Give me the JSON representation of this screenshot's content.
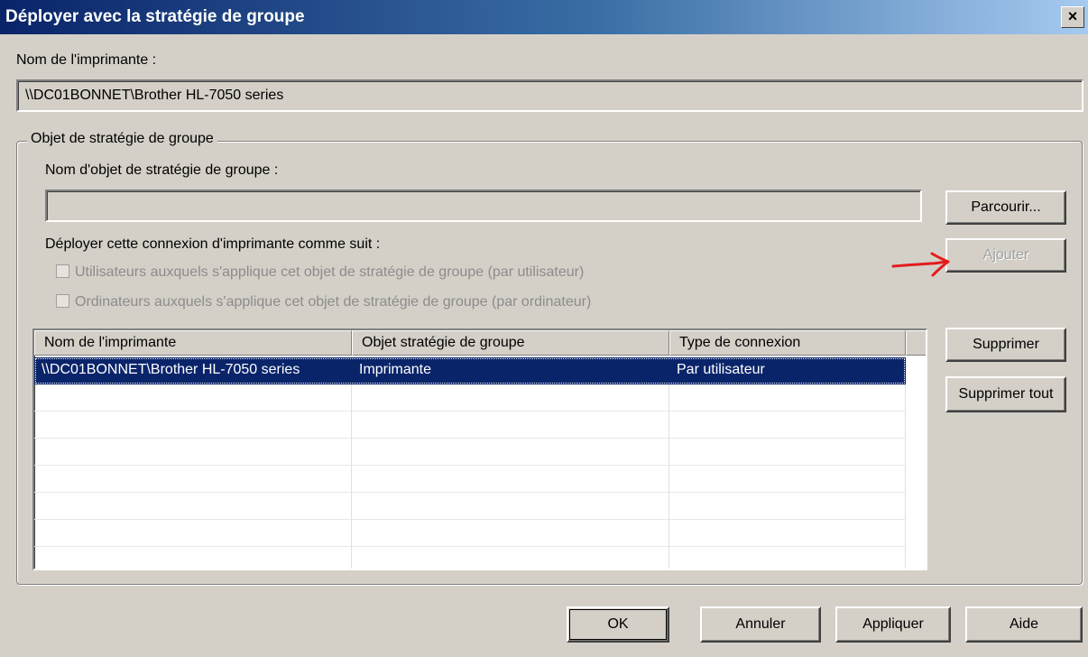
{
  "window": {
    "title": "Déployer avec la stratégie de groupe",
    "close_glyph": "×"
  },
  "printer_name_label": "Nom de l'imprimante :",
  "printer_name_value": "\\\\DC01BONNET\\Brother HL-7050 series",
  "gpo_group": {
    "legend": "Objet de stratégie de groupe",
    "gpo_name_label": "Nom d'objet de stratégie de groupe :",
    "gpo_name_value": "",
    "deploy_label": "Déployer cette connexion d'imprimante comme suit :",
    "checkbox_users": "Utilisateurs auxquels s'applique cet objet de stratégie de groupe (par utilisateur)",
    "checkbox_computers": "Ordinateurs auxquels s'applique cet objet de stratégie de groupe (par ordinateur)",
    "browse_button": "Parcourir...",
    "add_button": "Ajouter",
    "remove_button": "Supprimer",
    "remove_all_button": "Supprimer tout"
  },
  "list": {
    "columns": [
      "Nom de l'imprimante",
      "Objet stratégie de groupe",
      "Type de connexion"
    ],
    "rows": [
      [
        "\\\\DC01BONNET\\Brother HL-7050 series",
        "Imprimante",
        "Par utilisateur"
      ]
    ]
  },
  "footer": {
    "ok_button": "OK",
    "cancel_button": "Annuler",
    "apply_button": "Appliquer",
    "help_button": "Aide"
  },
  "colors": {
    "annotation_arrow": "#e31b1b",
    "selection": "#0a246a",
    "dialog_face": "#d4d0c8"
  }
}
